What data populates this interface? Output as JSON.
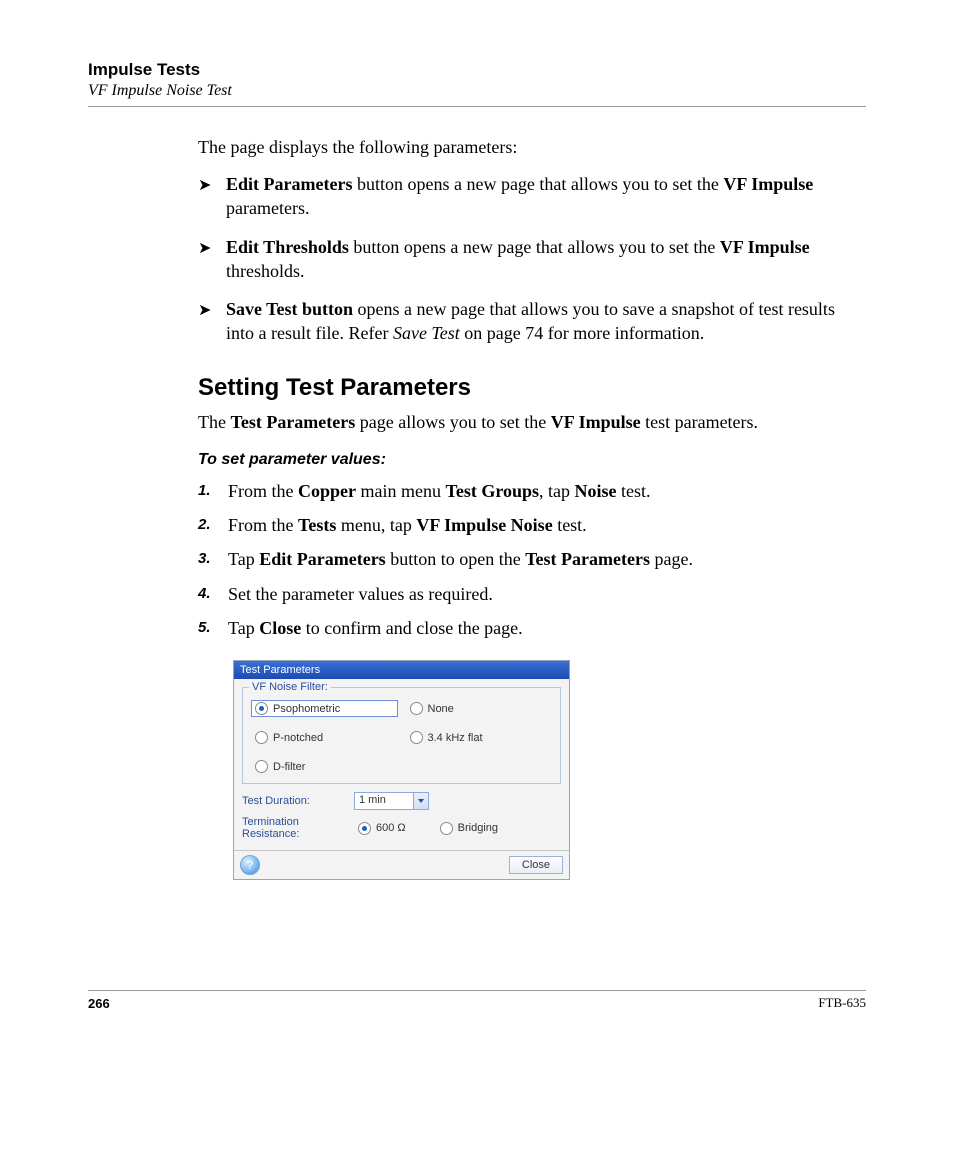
{
  "header": {
    "title": "Impulse Tests",
    "subtitle": "VF Impulse Noise Test"
  },
  "intro": "The page displays the following parameters:",
  "bullets": [
    {
      "lead": "Edit Parameters",
      "rest": " button opens a new page that allows you to set the ",
      "bold2": "VF Impulse",
      "tail": " parameters."
    },
    {
      "lead": "Edit Thresholds",
      "rest": " button opens a new page that allows you to set the ",
      "bold2": "VF Impulse",
      "tail": " thresholds."
    },
    {
      "lead": "Save Test button",
      "rest": " opens a new page that allows you to save a snapshot of test results into a result file. Refer ",
      "ital": "Save Test",
      "tail2": " on page 74 for more information."
    }
  ],
  "heading": "Setting Test Parameters",
  "para": {
    "p1": "The ",
    "b1": "Test Parameters",
    "p2": " page allows you to set the ",
    "b2": "VF Impulse",
    "p3": " test parameters."
  },
  "subheading": "To set parameter values:",
  "steps": [
    {
      "n": "1.",
      "a": "From the ",
      "b1": "Copper",
      "c": " main menu ",
      "b2": "Test Groups",
      "d": ", tap ",
      "b3": "Noise",
      "e": " test."
    },
    {
      "n": "2.",
      "a": "From the ",
      "b1": "Tests",
      "c": " menu, tap ",
      "b2": "VF Impulse Noise",
      "d": " test."
    },
    {
      "n": "3.",
      "a": "Tap ",
      "b1": "Edit Parameters",
      "c": " button to open the ",
      "b2": "Test Parameters",
      "d": " page."
    },
    {
      "n": "4.",
      "a": "Set the parameter values as required."
    },
    {
      "n": "5.",
      "a": "Tap ",
      "b1": "Close",
      "c": " to confirm and close the page."
    }
  ],
  "dialog": {
    "title": "Test Parameters",
    "filterLegend": "VF Noise Filter:",
    "filters": {
      "psophometric": "Psophometric",
      "none": "None",
      "pnotched": "P-notched",
      "flat": "3.4 kHz flat",
      "dfilter": "D-filter"
    },
    "durationLabel": "Test Duration:",
    "durationValue": "1 min",
    "termLabel": "Termination Resistance:",
    "term600": "600 Ω",
    "termBridging": "Bridging",
    "help": "?",
    "close": "Close"
  },
  "footer": {
    "page": "266",
    "doc": "FTB-635"
  }
}
